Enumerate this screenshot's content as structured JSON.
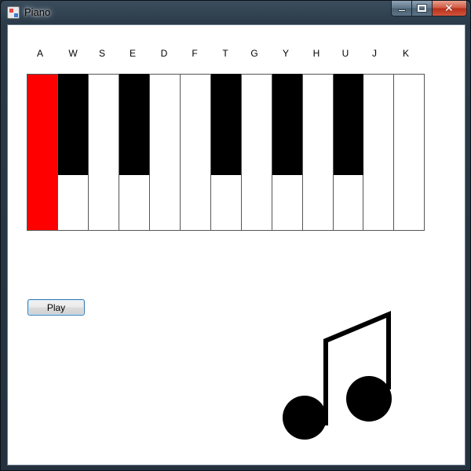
{
  "window": {
    "title": "Piano"
  },
  "piano": {
    "labels": [
      "A",
      "W",
      "S",
      "E",
      "D",
      "F",
      "T",
      "G",
      "Y",
      "H",
      "U",
      "J",
      "K"
    ],
    "pressed_key": "A",
    "pressed_color": "#ff0000"
  },
  "controls": {
    "play_label": "Play"
  },
  "icons": {
    "note": "music-note-icon"
  }
}
